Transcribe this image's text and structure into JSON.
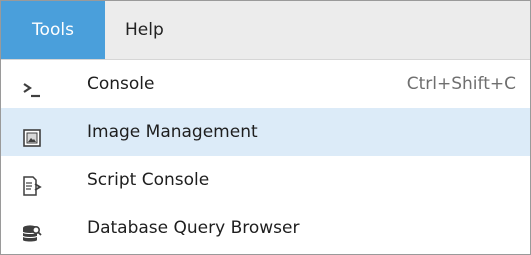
{
  "menubar": {
    "tools_label": "Tools",
    "help_label": "Help"
  },
  "menu": {
    "items": [
      {
        "label": "Console",
        "shortcut": "Ctrl+Shift+C",
        "icon": "console-icon"
      },
      {
        "label": "Image Management",
        "shortcut": "",
        "icon": "image-icon"
      },
      {
        "label": "Script Console",
        "shortcut": "",
        "icon": "script-icon"
      },
      {
        "label": "Database Query Browser",
        "shortcut": "",
        "icon": "database-icon"
      }
    ]
  },
  "colors": {
    "menubar_active": "#4a9fdb",
    "item_highlight": "#dcebf8",
    "icon": "#4a4a4a"
  }
}
